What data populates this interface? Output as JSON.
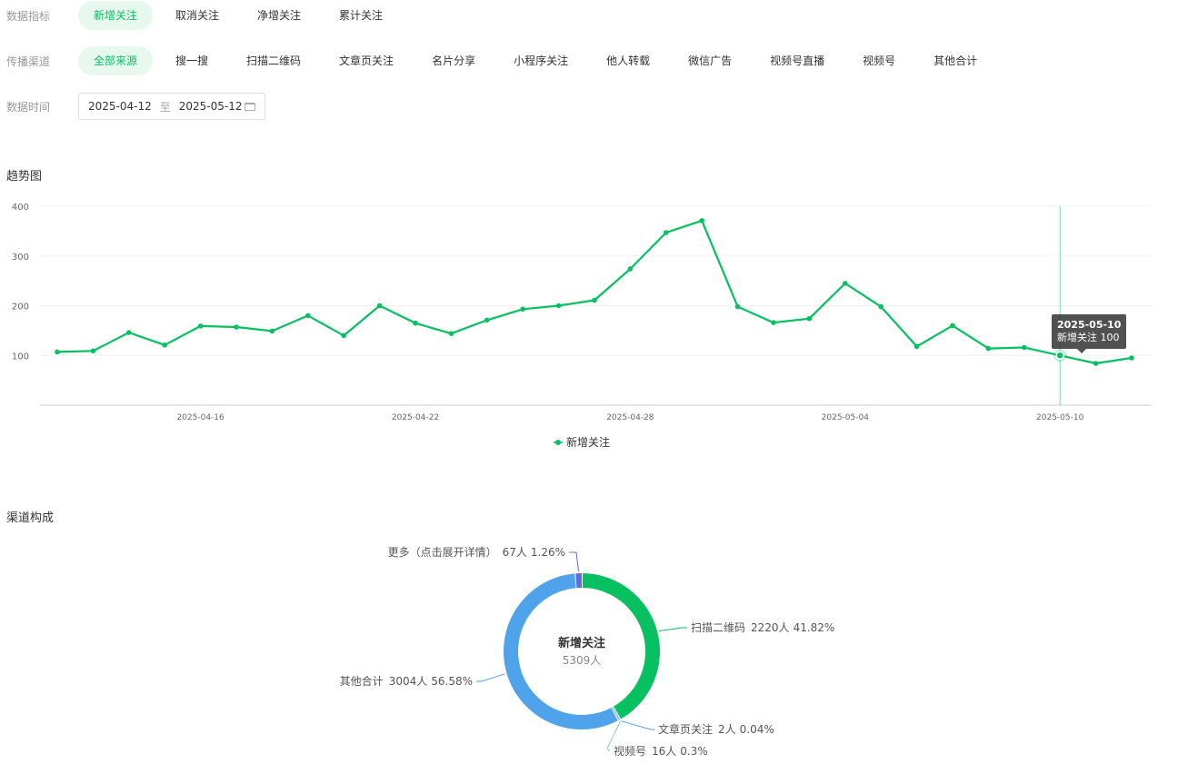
{
  "filters": {
    "metric": {
      "label": "数据指标",
      "options": [
        "新增关注",
        "取消关注",
        "净增关注",
        "累计关注"
      ],
      "active": 0
    },
    "channel": {
      "label": "传播渠道",
      "options": [
        "全部来源",
        "搜一搜",
        "扫描二维码",
        "文章页关注",
        "名片分享",
        "小程序关注",
        "他人转载",
        "微信广告",
        "视频号直播",
        "视频号",
        "其他合计"
      ],
      "active": 0
    },
    "date": {
      "label": "数据时间",
      "start": "2025-04-12",
      "separator": "至",
      "end": "2025-05-12"
    }
  },
  "trend": {
    "title": "趋势图",
    "tooltip": {
      "date": "2025-05-10",
      "series": "新增关注",
      "value": "100"
    }
  },
  "composition": {
    "title": "渠道构成",
    "center_title": "新增关注",
    "center_value": "5309人"
  },
  "colors": {
    "accent": "#07c160",
    "blue": "#4fa3ea",
    "purple": "#5b6fd6",
    "light_blue": "#88c4f0"
  },
  "chart_data": [
    {
      "type": "line",
      "x": [
        "2025-04-12",
        "2025-04-13",
        "2025-04-14",
        "2025-04-15",
        "2025-04-16",
        "2025-04-17",
        "2025-04-18",
        "2025-04-19",
        "2025-04-20",
        "2025-04-21",
        "2025-04-22",
        "2025-04-23",
        "2025-04-24",
        "2025-04-25",
        "2025-04-26",
        "2025-04-27",
        "2025-04-28",
        "2025-04-29",
        "2025-04-30",
        "2025-05-01",
        "2025-05-02",
        "2025-05-03",
        "2025-05-04",
        "2025-05-05",
        "2025-05-06",
        "2025-05-07",
        "2025-05-08",
        "2025-05-09",
        "2025-05-10",
        "2025-05-11",
        "2025-05-12"
      ],
      "series": [
        {
          "name": "新增关注",
          "values": [
            107,
            109,
            146,
            121,
            159,
            157,
            149,
            180,
            140,
            200,
            165,
            144,
            171,
            193,
            200,
            211,
            274,
            347,
            371,
            198,
            166,
            174,
            245,
            198,
            118,
            160,
            114,
            116,
            100,
            84,
            95
          ]
        }
      ],
      "x_ticks": [
        "2025-04-16",
        "2025-04-22",
        "2025-04-28",
        "2025-05-04",
        "2025-05-10"
      ],
      "y_ticks": [
        "100",
        "200",
        "300",
        "400"
      ],
      "ylim": [
        0,
        400
      ],
      "grid": true,
      "legend": "bottom-center",
      "highlight": "2025-05-10"
    },
    {
      "type": "pie",
      "labels": [
        "扫描二维码",
        "文章页关注",
        "视频号",
        "其他合计",
        "更多（点击展开详情）"
      ],
      "counts": [
        "2220人",
        "2人",
        "16人",
        "3004人",
        "67人"
      ],
      "percents": [
        "41.82%",
        "0.04%",
        "0.3%",
        "56.58%",
        "1.26%"
      ],
      "values": [
        41.82,
        0.04,
        0.3,
        56.58,
        1.26
      ],
      "colors": [
        "#07c160",
        "#4fa3ea",
        "#88c4f0",
        "#4fa3ea",
        "#5b6fd6"
      ]
    }
  ]
}
